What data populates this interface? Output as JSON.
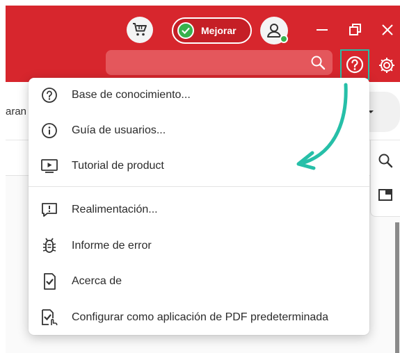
{
  "header": {
    "upgrade_label": "Mejorar",
    "search_placeholder": ""
  },
  "background": {
    "partial_text": "aran"
  },
  "help_menu": {
    "items": [
      {
        "label": "Base de conocimiento...",
        "icon": "question-circle-icon"
      },
      {
        "label": "Guía de usuarios...",
        "icon": "info-circle-icon"
      },
      {
        "label": "Tutorial de product",
        "icon": "video-play-icon"
      },
      {
        "label": "Realimentación...",
        "icon": "feedback-icon"
      },
      {
        "label": "Informe de error",
        "icon": "bug-icon"
      },
      {
        "label": "Acerca de",
        "icon": "about-icon"
      },
      {
        "label": "Configurar como aplicación de PDF predeterminada",
        "icon": "default-app-icon"
      }
    ]
  },
  "colors": {
    "header_red": "#d7262d",
    "search_red": "#e4575c",
    "highlight_teal": "#26bfa8",
    "status_green": "#37b24d"
  }
}
